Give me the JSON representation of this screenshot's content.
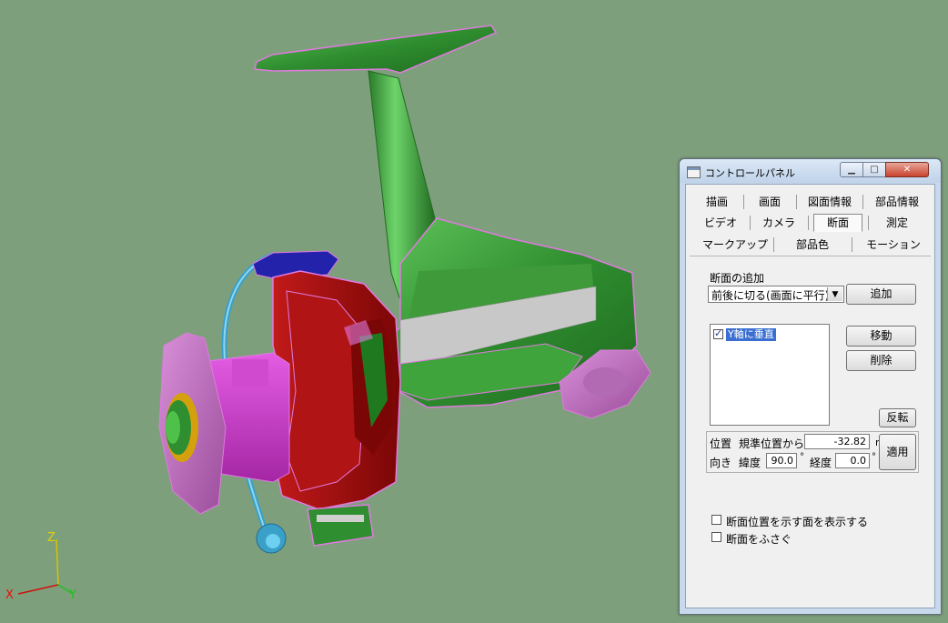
{
  "window": {
    "title": "コントロールパネル"
  },
  "tabs": [
    {
      "label": "描画"
    },
    {
      "label": "画面"
    },
    {
      "label": "図面情報"
    },
    {
      "label": "部品情報"
    },
    {
      "label": "ビデオ"
    },
    {
      "label": "カメラ"
    },
    {
      "label": "断面",
      "active": true
    },
    {
      "label": "測定"
    },
    {
      "label": "マークアップ"
    },
    {
      "label": "部品色"
    },
    {
      "label": "モーション"
    }
  ],
  "section": {
    "add_label": "断面の追加",
    "mode_select": "前後に切る(画面に平行)",
    "add_button": "追加",
    "list_items": [
      {
        "label": "Y軸に垂直",
        "checked": true,
        "selected": true
      }
    ],
    "move_button": "移動",
    "delete_button": "削除",
    "flip_button": "反転"
  },
  "position": {
    "position_label": "位置",
    "reference_label": "規準位置から",
    "offset_value": "-32.82",
    "offset_unit": "mm",
    "direction_label": "向き",
    "latitude_label": "緯度",
    "latitude_value": "90.0",
    "degree_unit": "°",
    "longitude_label": "経度",
    "longitude_value": "0.0",
    "apply_button": "適用"
  },
  "options": {
    "show_plane": {
      "label": "断面位置を示す面を表示する",
      "checked": false
    },
    "cap_section": {
      "label": "断面をふさぐ",
      "checked": false
    }
  },
  "axes": {
    "x": "X",
    "y": "Y",
    "z": "Z"
  },
  "colors": {
    "background": "#7e9f7c",
    "bail": "#2e8a2e",
    "body": "#3a9a3a",
    "spool_cut": "#a80d0d",
    "spool": "#cc33cc",
    "outline": "#e07ae0",
    "bail_wire": "#3aa0c8",
    "line_roller": "#2222aa"
  }
}
